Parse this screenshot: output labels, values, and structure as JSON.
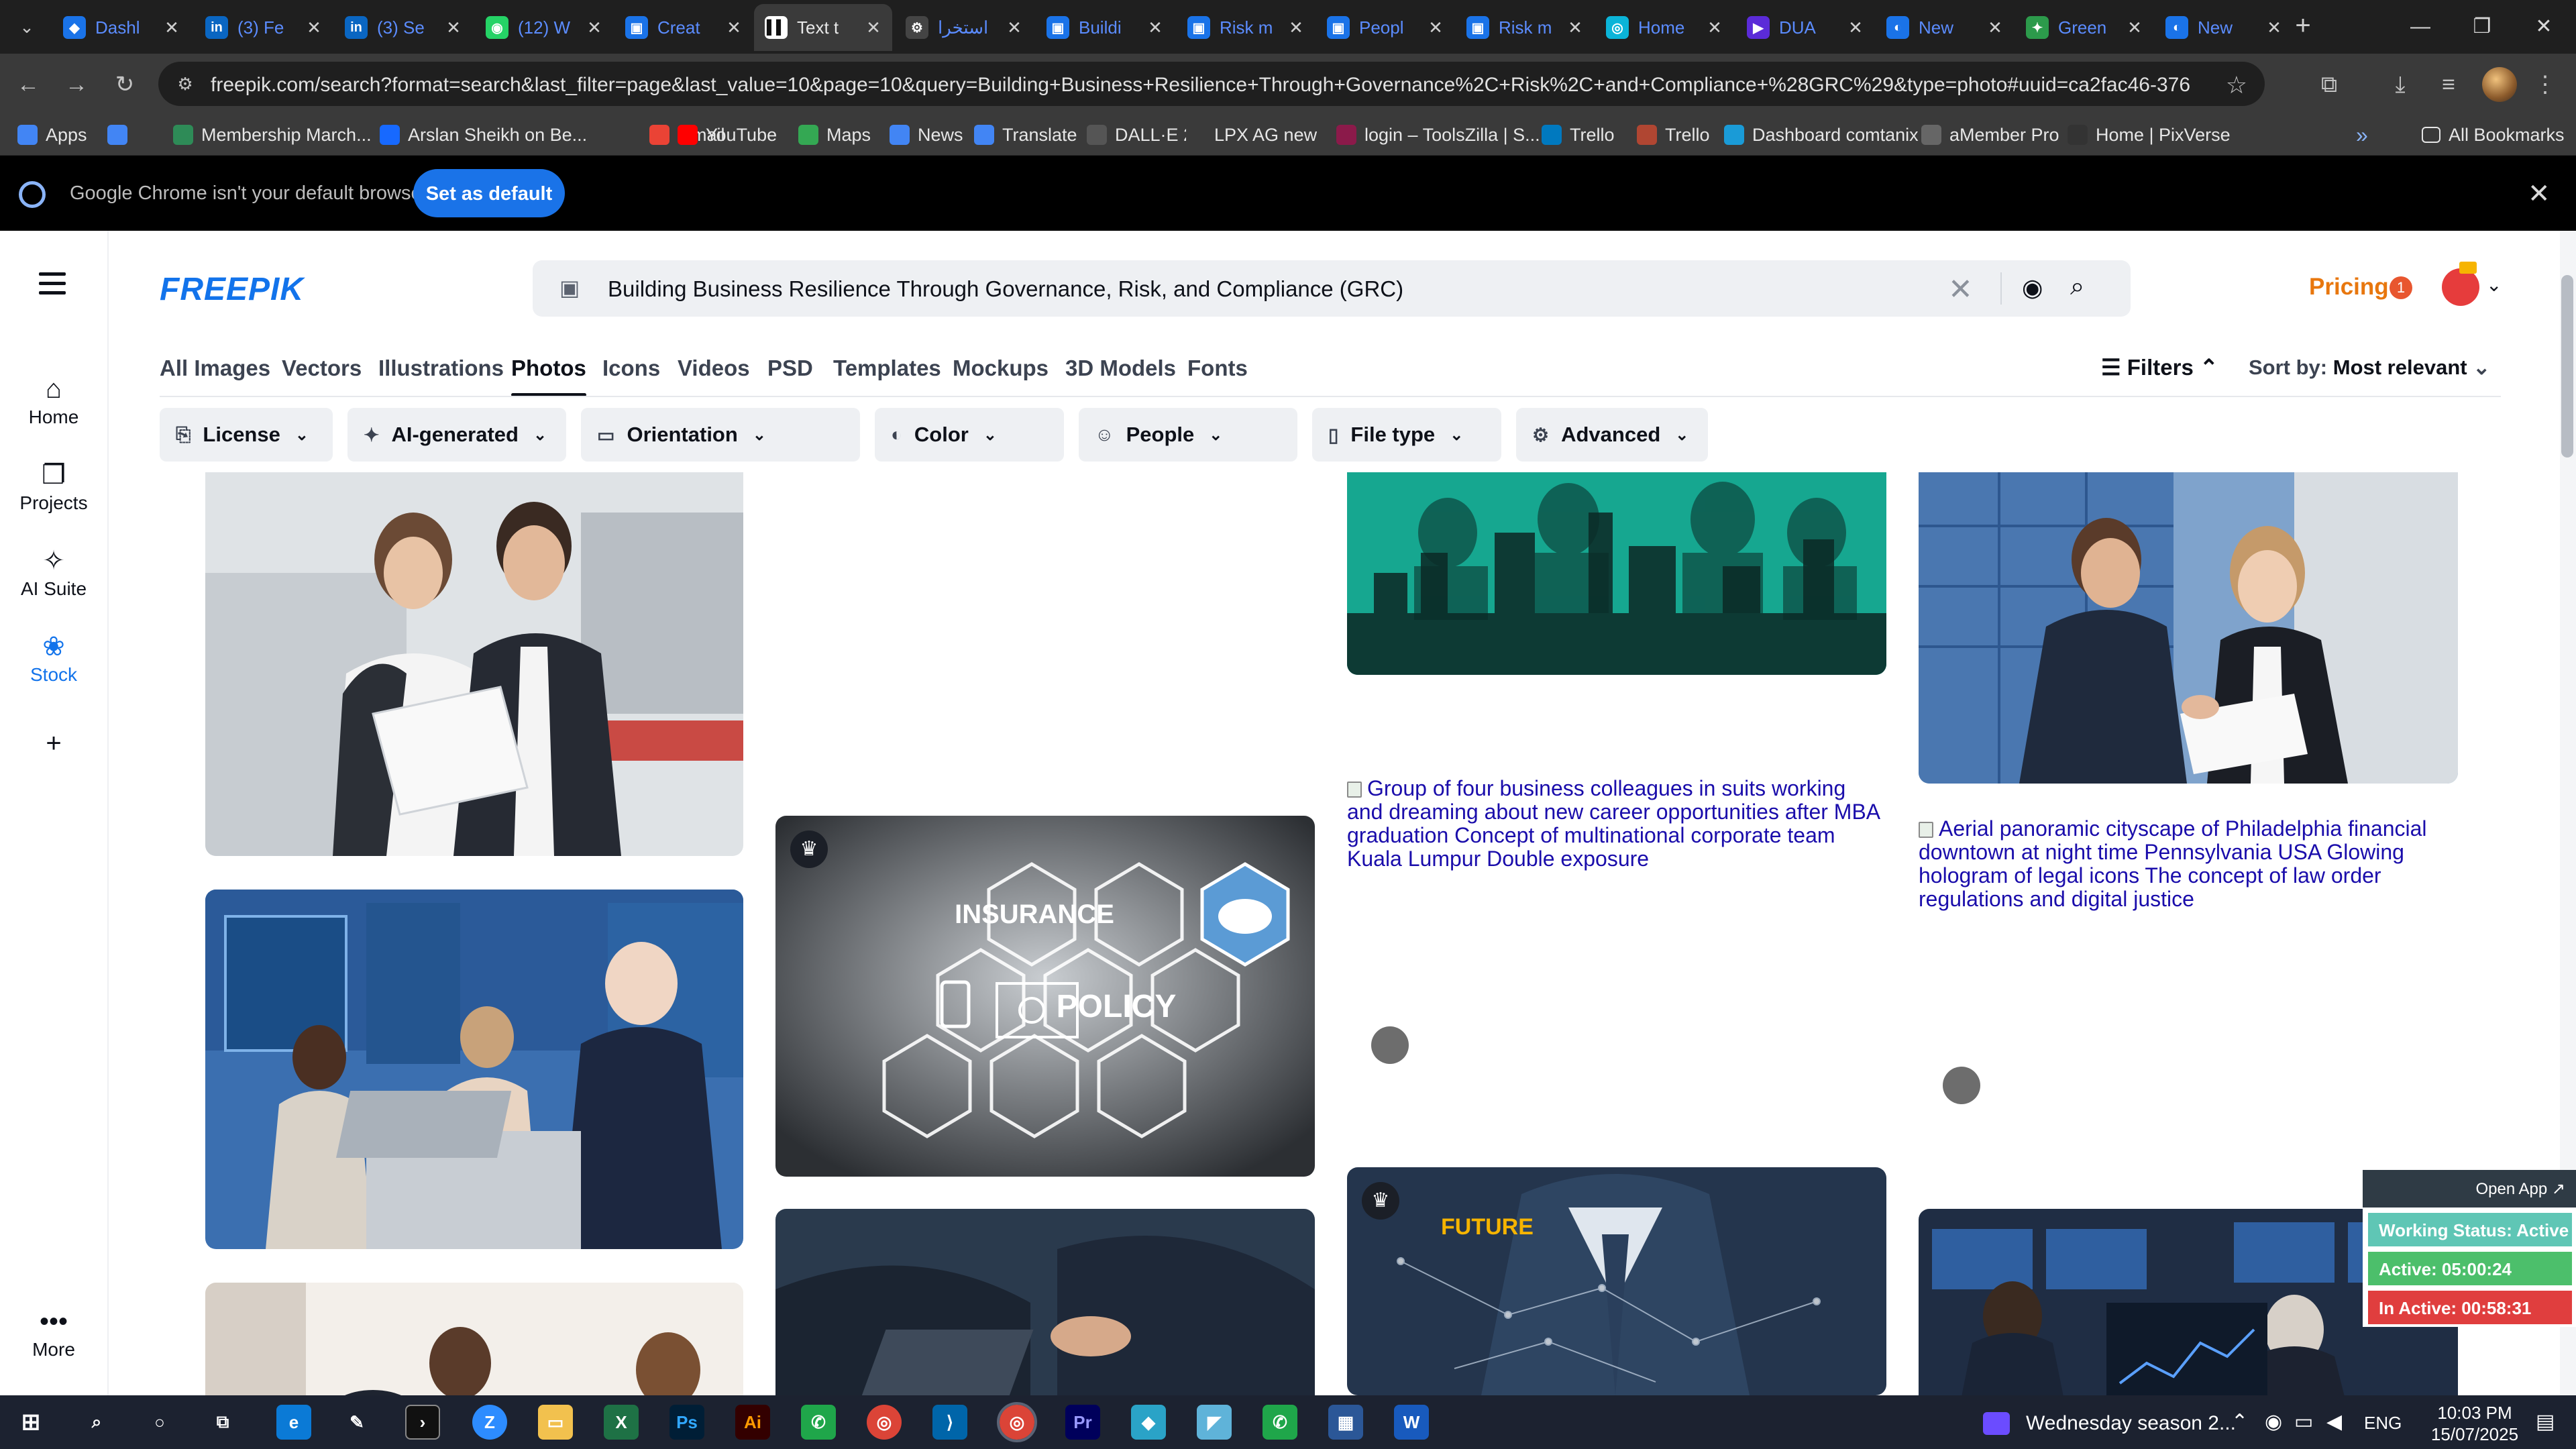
{
  "browser": {
    "tabs": [
      {
        "label": "Dashl",
        "color": "#1a73e8",
        "glyph": "◆"
      },
      {
        "label": "(3) Fe",
        "color": "#0a66c2",
        "glyph": "in"
      },
      {
        "label": "(3) Se",
        "color": "#0a66c2",
        "glyph": "in"
      },
      {
        "label": "(12) W",
        "color": "#25d366",
        "glyph": "◉"
      },
      {
        "label": "Creat",
        "color": "#1a73e8",
        "glyph": "▣"
      },
      {
        "label": "Text t",
        "color": "#ffffff",
        "glyph": "▌▌"
      },
      {
        "label": "استخرا",
        "color": "#444444",
        "glyph": "⚙"
      },
      {
        "label": "Buildi",
        "color": "#1a73e8",
        "glyph": "▣"
      },
      {
        "label": "Risk m",
        "color": "#1a73e8",
        "glyph": "▣"
      },
      {
        "label": "Peopl",
        "color": "#1a73e8",
        "glyph": "▣"
      },
      {
        "label": "Risk m",
        "color": "#1a73e8",
        "glyph": "▣"
      },
      {
        "label": "Home",
        "color": "#0bb4d8",
        "glyph": "◎"
      },
      {
        "label": "DUA",
        "color": "#5b2bd8",
        "glyph": "▶"
      },
      {
        "label": "New",
        "color": "#1a73e8",
        "glyph": "◐"
      },
      {
        "label": "Green",
        "color": "#2c9a4b",
        "glyph": "✦"
      },
      {
        "label": "New",
        "color": "#1a73e8",
        "glyph": "◐"
      }
    ],
    "active_tab_index": 5,
    "url": "freepik.com/search?format=search&last_filter=page&last_value=10&page=10&query=Building+Business+Resilience+Through+Governance%2C+Risk%2C+and+Compliance+%28GRC%29&type=photo#uuid=ca2fac46-376d-4ca8-8abf-f91f37...",
    "bookmarks": [
      {
        "label": "Apps",
        "color": "#4285f4"
      },
      {
        "label": "",
        "color": "#4285f4"
      },
      {
        "label": "Membership March...",
        "color": "#2e8b57"
      },
      {
        "label": "Arslan Sheikh on Be...",
        "color": "#1769ff"
      },
      {
        "label": "Gmail",
        "color": "#ea4335"
      },
      {
        "label": "YouTube",
        "color": "#ff0000"
      },
      {
        "label": "Maps",
        "color": "#34a853"
      },
      {
        "label": "News",
        "color": "#4285f4"
      },
      {
        "label": "Translate",
        "color": "#4285f4"
      },
      {
        "label": "DALL·E 2",
        "color": "#555555"
      },
      {
        "label": "LPX AG new",
        "color": "#3a3a3a"
      },
      {
        "label": "login – ToolsZilla | S...",
        "color": "#8b1a4a"
      },
      {
        "label": "Trello",
        "color": "#0079bf"
      },
      {
        "label": "Trello",
        "color": "#b04632"
      },
      {
        "label": "Dashboard comtanix",
        "color": "#1a9bd7"
      },
      {
        "label": "aMember Pro",
        "color": "#666666"
      },
      {
        "label": "Home | PixVerse",
        "color": "#333333"
      }
    ],
    "all_bookmarks": "All Bookmarks",
    "infobar_text": "Google Chrome isn't your default browser",
    "infobar_button": "Set as default"
  },
  "nav": {
    "items": [
      {
        "label": "Home",
        "icon": "home-icon",
        "glyph": "⌂"
      },
      {
        "label": "Projects",
        "icon": "projects-icon",
        "glyph": "❐"
      },
      {
        "label": "AI Suite",
        "icon": "ai-suite-icon",
        "glyph": "✧"
      },
      {
        "label": "Stock",
        "icon": "stock-icon",
        "glyph": "❀"
      }
    ],
    "more": "More"
  },
  "header": {
    "logo": "FREEPIK",
    "search_query": "Building Business Resilience Through Governance, Risk, and Compliance (GRC)",
    "pricing": "Pricing",
    "notification_count": "1"
  },
  "type_tabs": [
    "All Images",
    "Vectors",
    "Illustrations",
    "Photos",
    "Icons",
    "Videos",
    "PSD",
    "Templates",
    "Mockups",
    "3D Models",
    "Fonts"
  ],
  "active_type_tab": "Photos",
  "filters_label": "Filters",
  "sort": {
    "label": "Sort by:",
    "value": "Most relevant"
  },
  "filter_chips": [
    "License",
    "AI-generated",
    "Orientation",
    "Color",
    "People",
    "File type",
    "Advanced"
  ],
  "results": {
    "broken_1": "Group of four business colleagues in suits working and dreaming about new career opportunities after MBA graduation Concept of multinational corporate team Kuala Lumpur Double exposure",
    "broken_2": "Aerial panoramic cityscape of Philadelphia financial downtown at night time Pennsylvania USA Glowing hologram of legal icons The concept of law order regulations and digital justice",
    "policy_word_1": "INSURANCE",
    "policy_word_2": "POLICY",
    "future_word": "FUTURE"
  },
  "status_widget": {
    "open_app": "Open App ↗",
    "working": "Working Status: Active",
    "active": "Active: 05:00:24",
    "inactive": "In Active: 00:58:31",
    "colors": {
      "working": "#5fc6b5",
      "active": "#4cbf6b",
      "inactive": "#e03e3e"
    }
  },
  "taskbar": {
    "media_title": "Wednesday season 2...",
    "lang": "ENG",
    "time": "10:03 PM",
    "date": "15/07/2025"
  }
}
